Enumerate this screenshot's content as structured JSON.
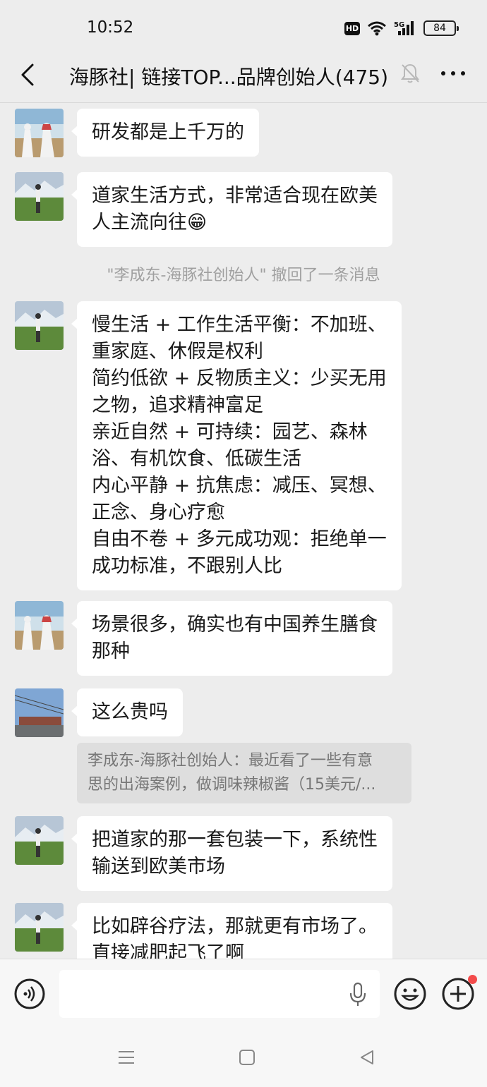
{
  "status": {
    "time": "10:52",
    "hd": "HD",
    "network": "5G",
    "battery": "84"
  },
  "header": {
    "title": "海豚社| 链接TOP...品牌创始人(475)"
  },
  "messages": [
    {
      "type": "text",
      "avatar": "avatar-desert",
      "lines": [
        "研发都是上千万的"
      ]
    },
    {
      "type": "text",
      "avatar": "avatar-golfer",
      "lines": [
        "道家生活方式，非常适合现在欧美",
        "人主流向往😁"
      ]
    },
    {
      "type": "system",
      "text": "\"李成东-海豚社创始人\" 撤回了一条消息"
    },
    {
      "type": "text",
      "avatar": "avatar-golfer",
      "lines": [
        "慢生活 + 工作生活平衡：不加班、",
        "重家庭、休假是权利",
        "简约低欲 + 反物质主义：少买无用",
        "之物，追求精神富足",
        "亲近自然 + 可持续：园艺、森林",
        "浴、有机饮食、低碳生活",
        "内心平静 + 抗焦虑：减压、冥想、",
        "正念、身心疗愈",
        "自由不卷 + 多元成功观：拒绝单一",
        "成功标准，不跟别人比"
      ]
    },
    {
      "type": "text",
      "avatar": "avatar-desert",
      "lines": [
        "场景很多，确实也有中国养生膳食",
        "那种"
      ]
    },
    {
      "type": "text",
      "avatar": "avatar-building",
      "lines": [
        "这么贵吗"
      ]
    },
    {
      "type": "quote",
      "lines": [
        "李成东-海豚社创始人：最近看了一些有意",
        "思的出海案例，做调味辣椒酱（15美元/..."
      ]
    },
    {
      "type": "text",
      "avatar": "avatar-golfer",
      "lines": [
        "把道家的那一套包装一下，系统性",
        "输送到欧美市场"
      ]
    },
    {
      "type": "text",
      "avatar": "avatar-golfer",
      "lines": [
        "比如辟谷疗法，那就更有市场了。",
        "直接减肥起飞了啊"
      ]
    }
  ],
  "input": {
    "value": "",
    "placeholder": ""
  },
  "icons": {
    "back": "back-arrow-icon",
    "mute": "bell-muted-icon",
    "more": "more-dots-icon",
    "voice": "voice-icon",
    "mic": "mic-icon",
    "emoji": "emoji-icon",
    "plus": "plus-icon"
  },
  "colors": {
    "background": "#ededed",
    "bubble": "#ffffff",
    "notification_dot": "#f34b4b"
  }
}
